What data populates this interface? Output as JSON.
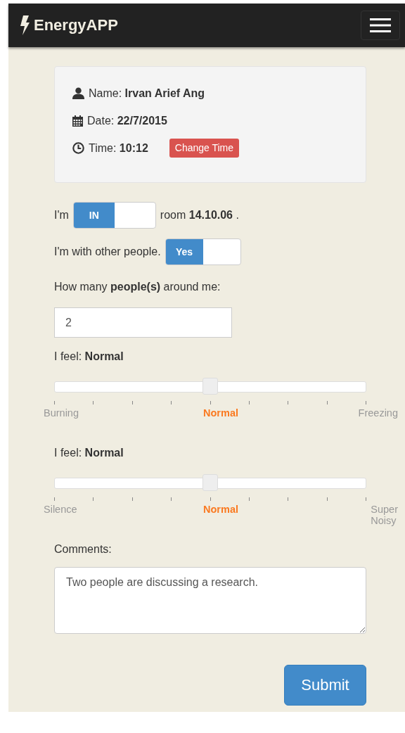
{
  "navbar": {
    "brand": "EnergyAPP"
  },
  "info": [
    {
      "kind": "person",
      "text": "Name: **Irvan Arief Ang**"
    },
    {
      "kind": "calendar",
      "text": "Date: **22/7/2015**"
    },
    {
      "kind": "clock",
      "text": "Time: **10:12**",
      "button": "Change Time"
    }
  ],
  "toggles": [
    {
      "before": "I'm",
      "label": "IN",
      "on": true,
      "after": "room **14.10.06** ."
    },
    {
      "before": "I'm with other people.",
      "label": "Yes",
      "on": true
    }
  ],
  "people": {
    "label": "How many **people(s)** around me:",
    "value": "2"
  },
  "sliders": [
    {
      "label": "I feel: **Normal**",
      "level": 0.5,
      "scale": [
        {
          "text": "Burning",
          "selected": false
        },
        {
          "text": "Normal",
          "selected": true
        },
        {
          "text": "Freezing",
          "selected": false
        }
      ]
    },
    {
      "label": "I feel: **Normal**",
      "level": 0.5,
      "scale": [
        {
          "text": "Silence",
          "selected": false
        },
        {
          "text": "Normal",
          "selected": true
        },
        {
          "text": "Super Noisy",
          "selected": false
        }
      ]
    }
  ],
  "comments": {
    "label": "Comments:",
    "value": "Two people are discussing a research."
  },
  "submit": "Submit"
}
